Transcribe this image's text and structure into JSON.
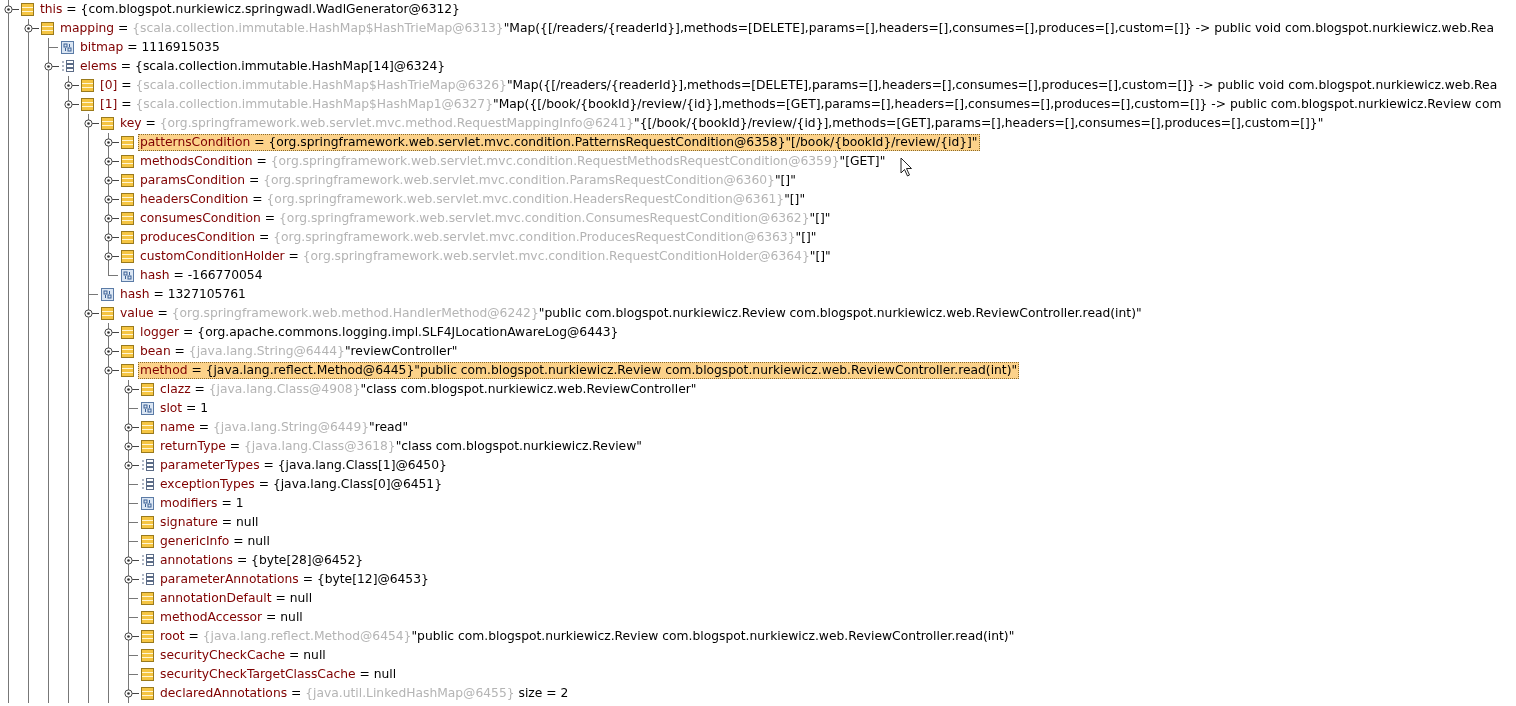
{
  "variables": [
    {
      "name": "this",
      "op": "=",
      "value": "{com.blogspot.nurkiewicz.springwadl.WadlGenerator@6312}",
      "kind": "object",
      "expanded": true,
      "selected": false,
      "children": [
        {
          "name": "mapping",
          "op": "=",
          "type": "{scala.collection.immutable.HashMap$HashTrieMap@6313}",
          "value": "\"Map({[/readers/{readerId}],methods=[DELETE],params=[],headers=[],consumes=[],produces=[],custom=[]} -> public void com.blogspot.nurkiewicz.web.Rea",
          "kind": "object",
          "expanded": true,
          "selected": false,
          "children": [
            {
              "name": "bitmap",
              "op": "=",
              "value": "1116915035",
              "kind": "primitive",
              "selected": false
            },
            {
              "name": "elems",
              "op": "=",
              "value": "{scala.collection.immutable.HashMap[14]@6324}",
              "kind": "array",
              "expanded": true,
              "selected": false,
              "children": [
                {
                  "name": "[0]",
                  "op": "=",
                  "type": "{scala.collection.immutable.HashMap$HashTrieMap@6326}",
                  "value": "\"Map({[/readers/{readerId}],methods=[DELETE],params=[],headers=[],consumes=[],produces=[],custom=[]} -> public void com.blogspot.nurkiewicz.web.Rea",
                  "kind": "object",
                  "expanded": false,
                  "selected": false
                },
                {
                  "name": "[1]",
                  "op": "=",
                  "type": "{scala.collection.immutable.HashMap$HashMap1@6327}",
                  "value": "\"Map({[/book/{bookId}/review/{id}],methods=[GET],params=[],headers=[],consumes=[],produces=[],custom=[]} -> public com.blogspot.nurkiewicz.Review com",
                  "kind": "object",
                  "expanded": true,
                  "selected": false,
                  "children": [
                    {
                      "name": "key",
                      "op": "=",
                      "type": "{org.springframework.web.servlet.mvc.method.RequestMappingInfo@6241}",
                      "value": "\"{[/book/{bookId}/review/{id}],methods=[GET],params=[],headers=[],consumes=[],produces=[],custom=[]}\"",
                      "kind": "object",
                      "expanded": true,
                      "selected": false,
                      "children": [
                        {
                          "name": "patternsCondition",
                          "op": "=",
                          "value": "{org.springframework.web.servlet.mvc.condition.PatternsRequestCondition@6358}\"[/book/{bookId}/review/{id}]\"",
                          "kind": "object",
                          "expanded": false,
                          "selected": true
                        },
                        {
                          "name": "methodsCondition",
                          "op": "=",
                          "type": "{org.springframework.web.servlet.mvc.condition.RequestMethodsRequestCondition@6359}",
                          "value": "\"[GET]\"",
                          "kind": "object",
                          "expanded": false,
                          "selected": false
                        },
                        {
                          "name": "paramsCondition",
                          "op": "=",
                          "type": "{org.springframework.web.servlet.mvc.condition.ParamsRequestCondition@6360}",
                          "value": "\"[]\"",
                          "kind": "object",
                          "expanded": false,
                          "selected": false
                        },
                        {
                          "name": "headersCondition",
                          "op": "=",
                          "type": "{org.springframework.web.servlet.mvc.condition.HeadersRequestCondition@6361}",
                          "value": "\"[]\"",
                          "kind": "object",
                          "expanded": false,
                          "selected": false
                        },
                        {
                          "name": "consumesCondition",
                          "op": "=",
                          "type": "{org.springframework.web.servlet.mvc.condition.ConsumesRequestCondition@6362}",
                          "value": "\"[]\"",
                          "kind": "object",
                          "expanded": false,
                          "selected": false
                        },
                        {
                          "name": "producesCondition",
                          "op": "=",
                          "type": "{org.springframework.web.servlet.mvc.condition.ProducesRequestCondition@6363}",
                          "value": "\"[]\"",
                          "kind": "object",
                          "expanded": false,
                          "selected": false
                        },
                        {
                          "name": "customConditionHolder",
                          "op": "=",
                          "type": "{org.springframework.web.servlet.mvc.condition.RequestConditionHolder@6364}",
                          "value": "\"[]\"",
                          "kind": "object",
                          "expanded": false,
                          "selected": false
                        },
                        {
                          "name": "hash",
                          "op": "=",
                          "value": "-166770054",
                          "kind": "primitive",
                          "selected": false
                        }
                      ]
                    },
                    {
                      "name": "hash",
                      "op": "=",
                      "value": "1327105761",
                      "kind": "primitive",
                      "selected": false
                    },
                    {
                      "name": "value",
                      "op": "=",
                      "type": "{org.springframework.web.method.HandlerMethod@6242}",
                      "value": "\"public com.blogspot.nurkiewicz.Review com.blogspot.nurkiewicz.web.ReviewController.read(int)\"",
                      "kind": "object",
                      "expanded": true,
                      "selected": false,
                      "children": [
                        {
                          "name": "logger",
                          "op": "=",
                          "value": "{org.apache.commons.logging.impl.SLF4JLocationAwareLog@6443}",
                          "kind": "object",
                          "expanded": false,
                          "selected": false
                        },
                        {
                          "name": "bean",
                          "op": "=",
                          "type": "{java.lang.String@6444}",
                          "value": "\"reviewController\"",
                          "kind": "object",
                          "expanded": false,
                          "selected": false
                        },
                        {
                          "name": "method",
                          "op": "=",
                          "value": "{java.lang.reflect.Method@6445}\"public com.blogspot.nurkiewicz.Review com.blogspot.nurkiewicz.web.ReviewController.read(int)\"",
                          "kind": "object",
                          "expanded": true,
                          "selected": true,
                          "children": [
                            {
                              "name": "clazz",
                              "op": "=",
                              "type": "{java.lang.Class@4908}",
                              "value": "\"class com.blogspot.nurkiewicz.web.ReviewController\"",
                              "kind": "object",
                              "expanded": false,
                              "selected": false
                            },
                            {
                              "name": "slot",
                              "op": "=",
                              "value": "1",
                              "kind": "primitive",
                              "selected": false
                            },
                            {
                              "name": "name",
                              "op": "=",
                              "type": "{java.lang.String@6449}",
                              "value": "\"read\"",
                              "kind": "object",
                              "expanded": false,
                              "selected": false
                            },
                            {
                              "name": "returnType",
                              "op": "=",
                              "type": "{java.lang.Class@3618}",
                              "value": "\"class com.blogspot.nurkiewicz.Review\"",
                              "kind": "object",
                              "expanded": false,
                              "selected": false
                            },
                            {
                              "name": "parameterTypes",
                              "op": "=",
                              "value": "{java.lang.Class[1]@6450}",
                              "kind": "array",
                              "expanded": false,
                              "selected": false
                            },
                            {
                              "name": "exceptionTypes",
                              "op": "=",
                              "value": "{java.lang.Class[0]@6451}",
                              "kind": "array",
                              "selected": false
                            },
                            {
                              "name": "modifiers",
                              "op": "=",
                              "value": "1",
                              "kind": "primitive",
                              "selected": false
                            },
                            {
                              "name": "signature",
                              "op": "=",
                              "value": "null",
                              "kind": "object",
                              "selected": false
                            },
                            {
                              "name": "genericInfo",
                              "op": "=",
                              "value": "null",
                              "kind": "object",
                              "selected": false
                            },
                            {
                              "name": "annotations",
                              "op": "=",
                              "value": "{byte[28]@6452}",
                              "kind": "array",
                              "expanded": false,
                              "selected": false
                            },
                            {
                              "name": "parameterAnnotations",
                              "op": "=",
                              "value": "{byte[12]@6453}",
                              "kind": "array",
                              "expanded": false,
                              "selected": false
                            },
                            {
                              "name": "annotationDefault",
                              "op": "=",
                              "value": "null",
                              "kind": "object",
                              "selected": false
                            },
                            {
                              "name": "methodAccessor",
                              "op": "=",
                              "value": "null",
                              "kind": "object",
                              "selected": false
                            },
                            {
                              "name": "root",
                              "op": "=",
                              "type": "{java.lang.reflect.Method@6454}",
                              "value": "\"public com.blogspot.nurkiewicz.Review com.blogspot.nurkiewicz.web.ReviewController.read(int)\"",
                              "kind": "object",
                              "expanded": false,
                              "selected": false
                            },
                            {
                              "name": "securityCheckCache",
                              "op": "=",
                              "value": "null",
                              "kind": "object",
                              "selected": false
                            },
                            {
                              "name": "securityCheckTargetClassCache",
                              "op": "=",
                              "value": "null",
                              "kind": "object",
                              "selected": false
                            },
                            {
                              "name": "declaredAnnotations",
                              "op": "=",
                              "type": "{java.util.LinkedHashMap@6455}",
                              "size": "size = 2",
                              "kind": "object",
                              "expanded": false,
                              "selected": false
                            }
                          ]
                        }
                      ]
                    }
                  ]
                }
              ]
            }
          ]
        }
      ]
    }
  ]
}
